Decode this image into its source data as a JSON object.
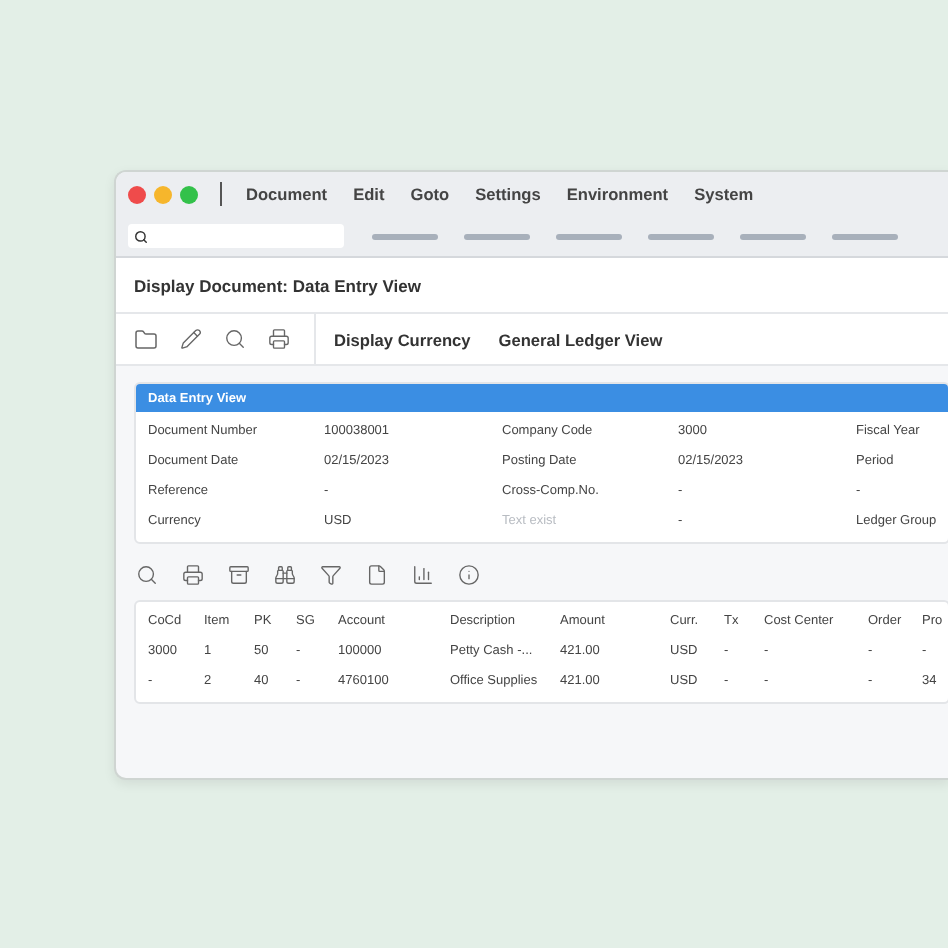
{
  "menu": [
    "Document",
    "Edit",
    "Goto",
    "Settings",
    "Environment",
    "System"
  ],
  "title": "Display Document: Data Entry View",
  "toolbar_buttons": [
    "Display Currency",
    "General Ledger View"
  ],
  "panel": {
    "title": "Data Entry View",
    "rows": [
      [
        {
          "text": "Document Number",
          "dim": false
        },
        {
          "text": "100038001",
          "dim": false
        },
        {
          "text": "Company Code",
          "dim": false
        },
        {
          "text": "3000",
          "dim": false
        },
        {
          "text": "Fiscal Year",
          "dim": false
        }
      ],
      [
        {
          "text": "Document Date",
          "dim": false
        },
        {
          "text": "02/15/2023",
          "dim": false
        },
        {
          "text": "Posting Date",
          "dim": false
        },
        {
          "text": "02/15/2023",
          "dim": false
        },
        {
          "text": "Period",
          "dim": false
        }
      ],
      [
        {
          "text": "Reference",
          "dim": false
        },
        {
          "text": "-",
          "dim": false
        },
        {
          "text": "Cross-Comp.No.",
          "dim": false
        },
        {
          "text": "-",
          "dim": false
        },
        {
          "text": "-",
          "dim": false
        }
      ],
      [
        {
          "text": "Currency",
          "dim": false
        },
        {
          "text": "USD",
          "dim": false
        },
        {
          "text": "Text exist",
          "dim": true
        },
        {
          "text": "-",
          "dim": false
        },
        {
          "text": "Ledger Group",
          "dim": false
        }
      ]
    ]
  },
  "table": {
    "columns": [
      "CoCd",
      "Item",
      "PK",
      "SG",
      "Account",
      "Description",
      "Amount",
      "Curr.",
      "Tx",
      "Cost Center",
      "Order",
      "Pro"
    ],
    "rows": [
      [
        "3000",
        "1",
        "50",
        "-",
        "100000",
        "Petty Cash -...",
        "421.00",
        "USD",
        "-",
        "-",
        "-",
        "-"
      ],
      [
        "-",
        "2",
        "40",
        "-",
        "4760100",
        "Office Supplies",
        "421.00",
        "USD",
        "-",
        "-",
        "-",
        "34"
      ]
    ]
  }
}
